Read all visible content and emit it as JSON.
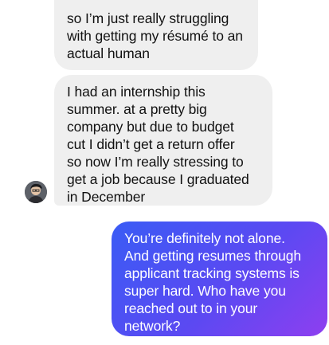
{
  "thread": {
    "messages": [
      {
        "direction": "incoming",
        "text": "so I’m just really struggling\nwith getting my résumé to an\nactual human"
      },
      {
        "direction": "incoming",
        "text": "I had an internship this\nsummer. at a pretty big\ncompany but due to budget\ncut I didn’t get a return offer\nso now I’m really stressing to\nget a job because I graduated\nin December"
      },
      {
        "direction": "outgoing",
        "text": "You’re definitely not alone.\nAnd getting resumes through\napplicant tracking systems is\nsuper hard. Who have you\nreached out to in your\nnetwork?"
      }
    ]
  },
  "colors": {
    "incoming_bubble": "#efefef",
    "outgoing_gradient_start": "#3a5cf5",
    "outgoing_gradient_end": "#8e3ff0"
  }
}
